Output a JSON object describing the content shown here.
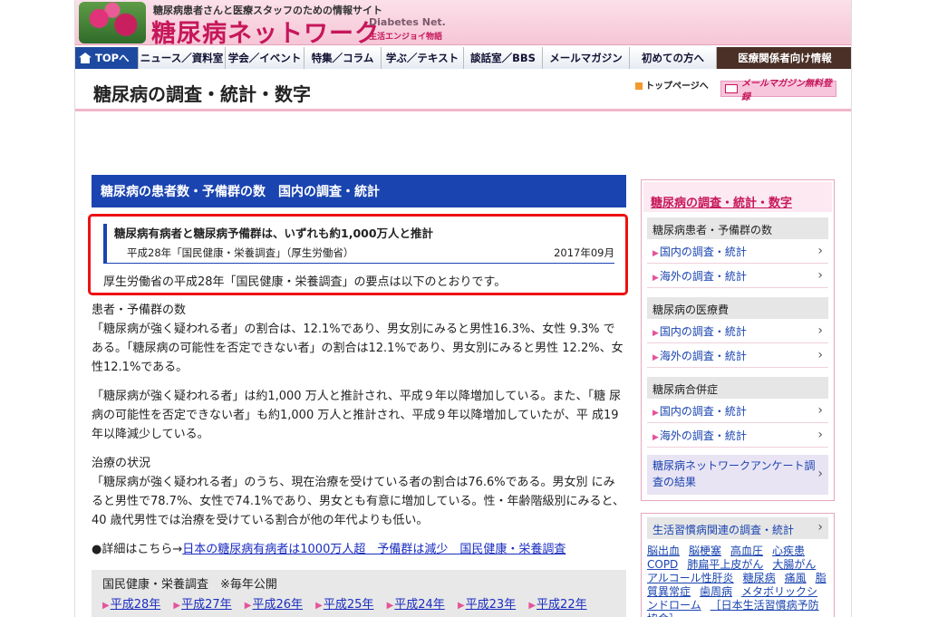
{
  "header": {
    "tagline": "糖尿病患者さんと医療スタッフのための情報サイト",
    "site_name": "糖尿病ネットワーク",
    "site_name_en": "Diabetes Net.",
    "sub_brand": "生活エンジョイ物語"
  },
  "nav": {
    "items": [
      "TOPへ",
      "ニュース／資料室",
      "学会／イベント",
      "特集／コラム",
      "学ぶ／テキスト",
      "談話室／BBS",
      "メールマガジン",
      "初めての方へ",
      "医療関係者向け情報"
    ]
  },
  "titlebar": {
    "title": "糖尿病の調査・統計・数字",
    "top_link": "トップページへ",
    "mail_button": "メールマガジン無料登録"
  },
  "main": {
    "section_title": "糖尿病の患者数・予備群の数　国内の調査・統計",
    "article": {
      "title": "糖尿病有病者と糖尿病予備群は、いずれも約1,000万人と推計",
      "source": "平成28年「国民健康・栄養調査」（厚生労働省）",
      "date": "2017年09月",
      "summary": "厚生労働省の平成28年「国民健康・栄養調査」の要点は以下のとおりです。"
    },
    "body": {
      "h1": "患者・予備群の数",
      "p1": "「糖尿病が強く疑われる者」の割合は、12.1%であり、男女別にみると男性16.3%、女性 9.3% である。「糖尿病の可能性を否定できない者」の割合は12.1%であり、男女別にみると男性 12.2%、女性12.1%である。",
      "p2": "「糖尿病が強く疑われる者」は約1,000 万人と推計され、平成９年以降増加している。また、「糖 尿病の可能性を否定できない者」も約1,000 万人と推計され、平成９年以降増加していたが、平 成19 年以降減少している。",
      "h2": "治療の状況",
      "p3": "「糖尿病が強く疑われる者」のうち、現在治療を受けている者の割合は76.6%である。男女別 にみると男性で78.7%、女性で74.1%であり、男女とも有意に増加している。性・年齢階級別にみると、40 歳代男性では治療を受けている割合が他の年代よりも低い。",
      "detail_prefix": "●詳細はこちら→",
      "detail_link": "日本の糖尿病有病者は1000万人超　予備群は減少　国民健康・栄養調査"
    },
    "survey": {
      "label": "国民健康・栄養調査　※毎年公開",
      "years": [
        "平成28年",
        "平成27年",
        "平成26年",
        "平成25年",
        "平成24年",
        "平成23年",
        "平成22年"
      ]
    }
  },
  "sidebar": {
    "title": "糖尿病の調査・統計・数字",
    "groups": [
      {
        "heading": "糖尿病患者・予備群の数",
        "links": [
          "国内の調査・統計",
          "海外の調査・統計"
        ]
      },
      {
        "heading": "糖尿病の医療費",
        "links": [
          "国内の調査・統計",
          "海外の調査・統計"
        ]
      },
      {
        "heading": "糖尿病合併症",
        "links": [
          "国内の調査・統計",
          "海外の調査・統計"
        ]
      }
    ],
    "survey_result": "糖尿病ネットワークアンケート調査の結果",
    "lifestyle": {
      "heading": "生活習慣病関連の調査・統計",
      "tags": [
        "脳出血",
        "脳梗塞",
        "高血圧",
        "心疾患",
        "COPD",
        "肺扁平上皮がん",
        "大腸がん",
        "アルコール性肝炎",
        "糖尿病",
        "痛風",
        "脂質異常症",
        "歯周病",
        "メタボリックシンドローム",
        "［日本生活習慣病予防協会］"
      ]
    }
  }
}
